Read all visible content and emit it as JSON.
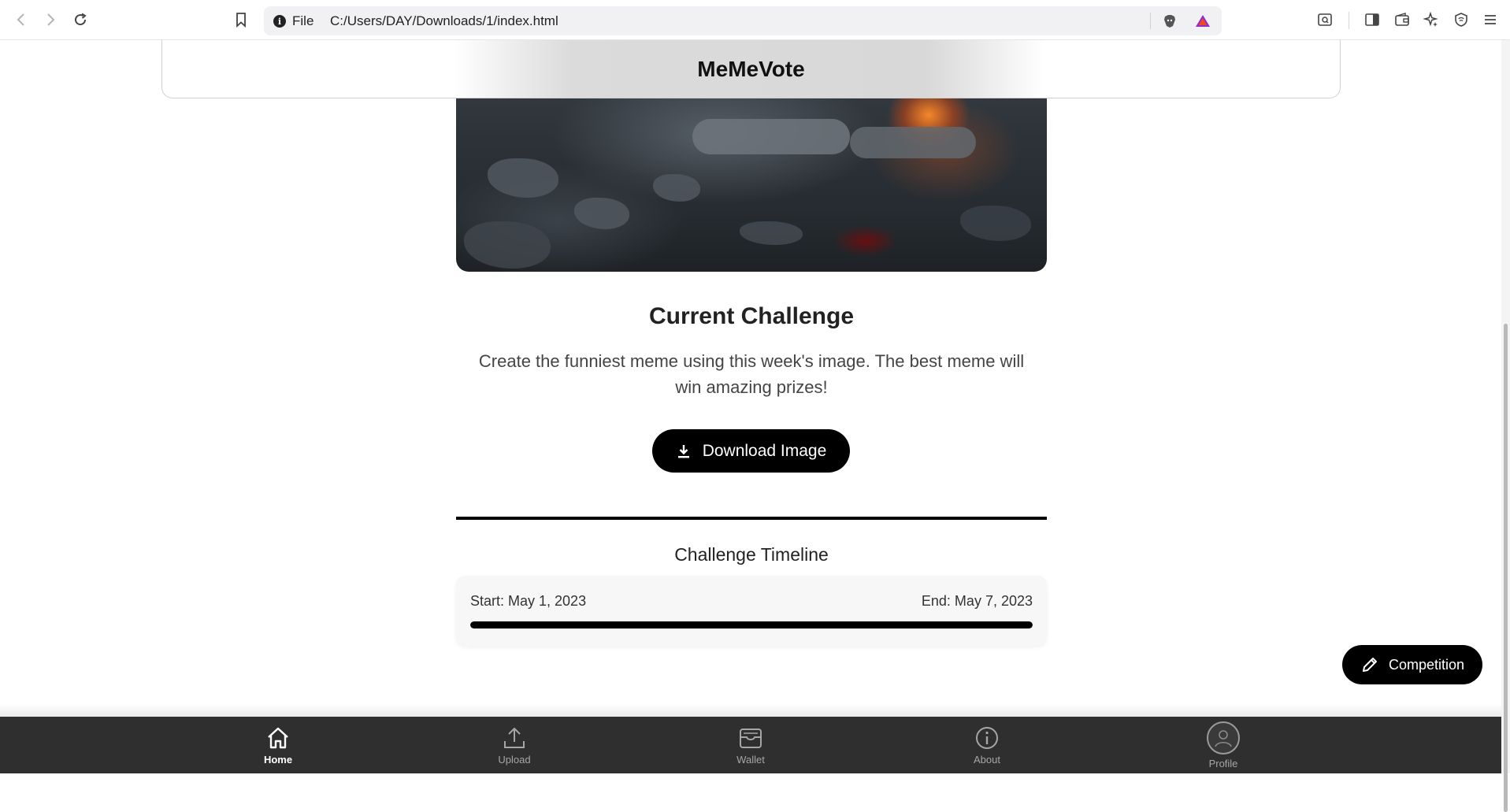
{
  "browser": {
    "file_label": "File",
    "url": "C:/Users/DAY/Downloads/1/index.html"
  },
  "app": {
    "title": "MeMeVote"
  },
  "challenge": {
    "title": "Current Challenge",
    "description": "Create the funniest meme using this week's image. The best meme will win amazing prizes!",
    "download_label": "Download Image"
  },
  "timeline": {
    "title": "Challenge Timeline",
    "start": "Start: May 1, 2023",
    "end": "End: May 7, 2023",
    "progress_fraction": 1.0
  },
  "competition_button": {
    "label": "Competition"
  },
  "bottom_nav": {
    "items": [
      {
        "label": "Home",
        "icon": "home-icon",
        "active": true
      },
      {
        "label": "Upload",
        "icon": "upload-icon",
        "active": false
      },
      {
        "label": "Wallet",
        "icon": "wallet-icon",
        "active": false
      },
      {
        "label": "About",
        "icon": "info-icon",
        "active": false
      },
      {
        "label": "Profile",
        "icon": "avatar-icon",
        "active": false
      }
    ]
  },
  "colors": {
    "accent": "#000000",
    "bottom_nav_bg": "#2f2f2f",
    "inactive_nav": "#a6a6a6"
  }
}
